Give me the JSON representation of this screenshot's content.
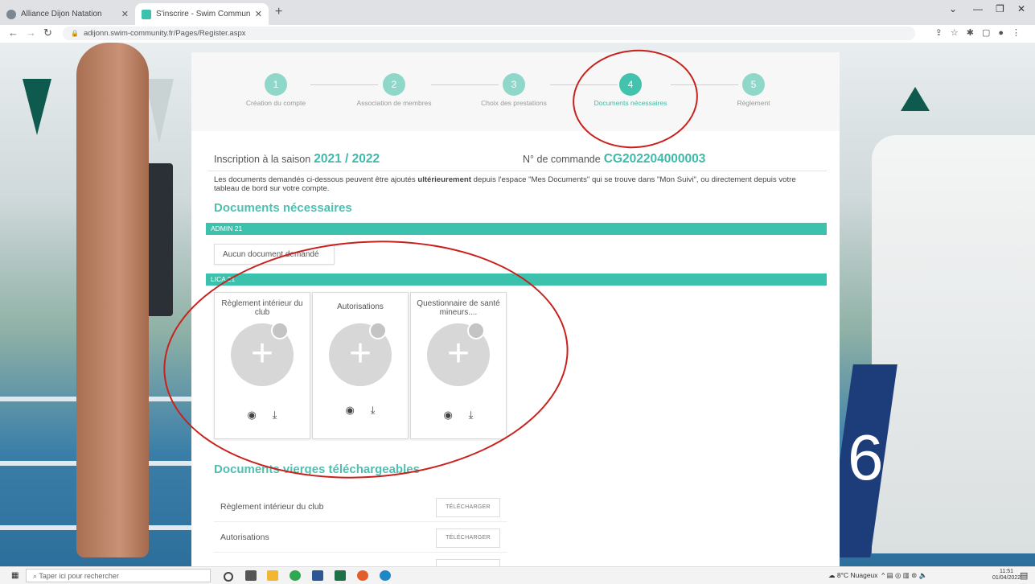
{
  "browser": {
    "tabs": [
      {
        "title": "Alliance Dijon Natation",
        "close": "✕"
      },
      {
        "title": "S'inscrire - Swim Community",
        "close": "✕"
      }
    ],
    "new_tab": "+",
    "url": "adijonn.swim-community.fr/Pages/Register.aspx"
  },
  "wizard": {
    "steps": [
      {
        "num": "1",
        "label": "Création du compte"
      },
      {
        "num": "2",
        "label": "Association de membres"
      },
      {
        "num": "3",
        "label": "Choix des prestations"
      },
      {
        "num": "4",
        "label": "Documents nécessaires"
      },
      {
        "num": "5",
        "label": "Règlement"
      }
    ]
  },
  "header": {
    "season_label": "Inscription à la saison",
    "season_value": "2021 / 2022",
    "order_label": "N° de commande",
    "order_value": "CG202204000003"
  },
  "intro": {
    "part1": "Les documents demandés ci-dessous peuvent être ajoutés ",
    "bold": "ultérieurement",
    "part2": " depuis l'espace \"Mes Documents\" qui se trouve dans \"Mon Suivi\", ou directement depuis votre tableau de bord sur votre compte."
  },
  "docs_title": "Documents nécessaires",
  "groups": [
    {
      "name": "ADMIN 21",
      "empty_text": "Aucun document demandé"
    },
    {
      "name": "LICA 21"
    }
  ],
  "cards": [
    {
      "title": "Règlement intérieur du club"
    },
    {
      "title": "Autorisations"
    },
    {
      "title": "Questionnaire de santé mineurs...."
    }
  ],
  "blank_docs_title": "Documents vierges téléchargeables",
  "blank_docs": [
    {
      "name": "Règlement intérieur du club",
      "button": "TÉLÉCHARGER"
    },
    {
      "name": "Autorisations",
      "button": "TÉLÉCHARGER"
    }
  ],
  "taskbar": {
    "search_placeholder": "Taper ici pour rechercher",
    "weather": "8°C Nuageux",
    "time": "11:51",
    "date": "01/04/2022"
  }
}
